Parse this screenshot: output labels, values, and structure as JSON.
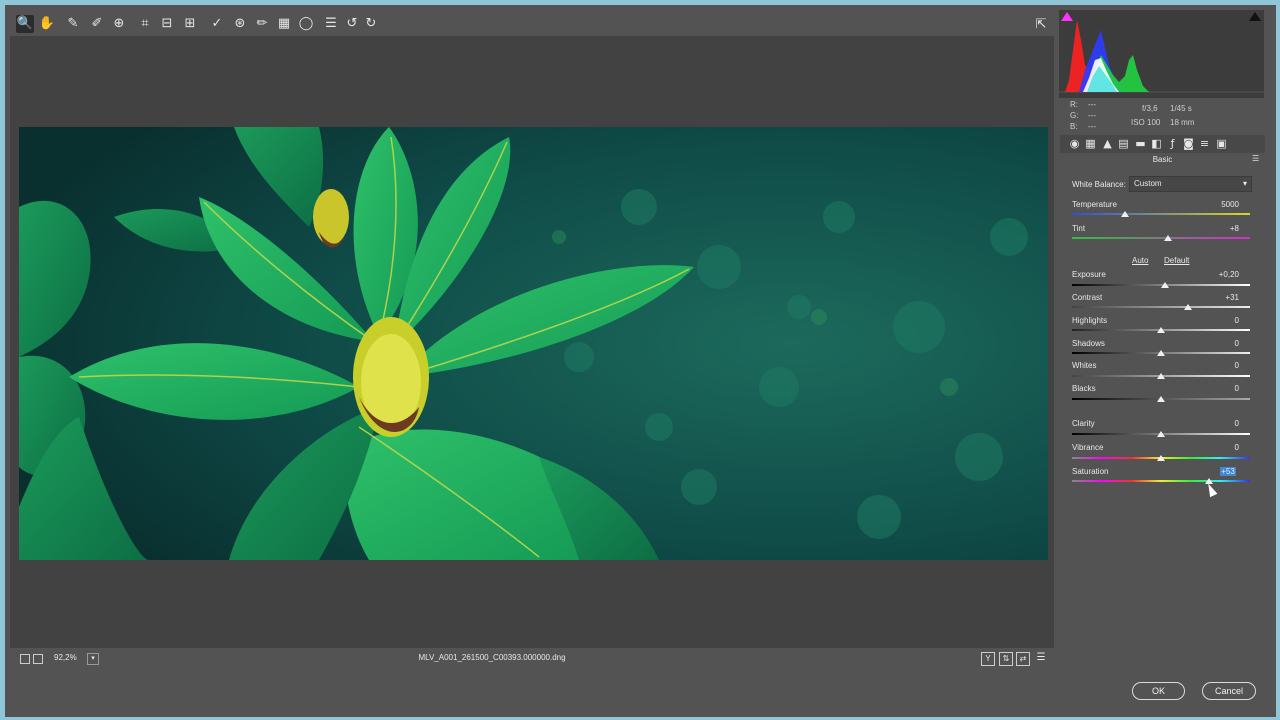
{
  "toolbar": {
    "tools": [
      {
        "name": "zoom-tool-icon",
        "glyph": "🔍"
      },
      {
        "name": "hand-tool-icon",
        "glyph": "✋"
      },
      {
        "name": "white-balance-tool-icon",
        "glyph": "✎"
      },
      {
        "name": "color-sampler-tool-icon",
        "glyph": "✐"
      },
      {
        "name": "targeted-adjustment-tool-icon",
        "glyph": "⊕"
      },
      {
        "name": "crop-tool-icon",
        "glyph": "⌗"
      },
      {
        "name": "straighten-tool-icon",
        "glyph": "⊟"
      },
      {
        "name": "transform-tool-icon",
        "glyph": "⊞"
      },
      {
        "name": "spot-removal-tool-icon",
        "glyph": "✓"
      },
      {
        "name": "red-eye-tool-icon",
        "glyph": "⊛"
      },
      {
        "name": "adjustment-brush-icon",
        "glyph": "✏"
      },
      {
        "name": "graduated-filter-icon",
        "glyph": "▦"
      },
      {
        "name": "radial-filter-icon",
        "glyph": "◯"
      },
      {
        "name": "preferences-icon",
        "glyph": "☰"
      },
      {
        "name": "rotate-left-icon",
        "glyph": "↺"
      },
      {
        "name": "rotate-right-icon",
        "glyph": "↻"
      }
    ],
    "fullscreen_glyph": "⇱"
  },
  "status": {
    "zoom": "92,2%",
    "filename": "MLV_A001_261500_C00393.000000.dng"
  },
  "info": {
    "r_label": "R:",
    "r_value": "---",
    "g_label": "G:",
    "g_value": "---",
    "b_label": "B:",
    "b_value": "---",
    "aperture": "f/3,6",
    "shutter": "1/45 s",
    "iso": "ISO 100",
    "focal": "18 mm"
  },
  "panel": {
    "title": "Basic",
    "white_balance_label": "White Balance:",
    "white_balance_value": "Custom",
    "auto": "Auto",
    "default": "Default",
    "sliders": {
      "temperature": {
        "label": "Temperature",
        "value": "5000",
        "level": 0.3
      },
      "tint": {
        "label": "Tint",
        "value": "+8",
        "level": 0.54
      },
      "exposure": {
        "label": "Exposure",
        "value": "+0,20",
        "level": 0.52
      },
      "contrast": {
        "label": "Contrast",
        "value": "+31",
        "level": 0.65
      },
      "highlights": {
        "label": "Highlights",
        "value": "0",
        "level": 0.5
      },
      "shadows": {
        "label": "Shadows",
        "value": "0",
        "level": 0.5
      },
      "whites": {
        "label": "Whites",
        "value": "0",
        "level": 0.5
      },
      "blacks": {
        "label": "Blacks",
        "value": "0",
        "level": 0.5
      },
      "clarity": {
        "label": "Clarity",
        "value": "0",
        "level": 0.5
      },
      "vibrance": {
        "label": "Vibrance",
        "value": "0",
        "level": 0.5
      },
      "saturation": {
        "label": "Saturation",
        "value": "+53",
        "level": 0.77
      }
    }
  },
  "dialog": {
    "ok": "OK",
    "cancel": "Cancel"
  },
  "colors": {
    "accent": "#3e88d4",
    "panel_bg": "#535353",
    "viewport_bg": "#424242"
  }
}
